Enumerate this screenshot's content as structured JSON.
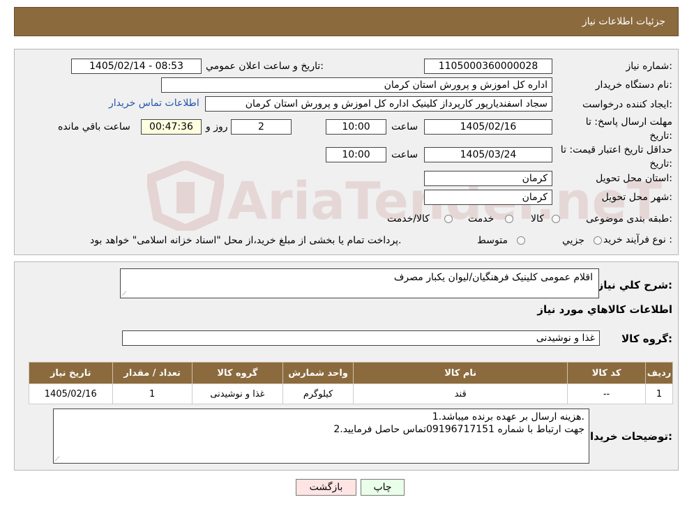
{
  "header": {
    "title": "جزئیات اطلاعات نیاز"
  },
  "watermark": {
    "text": "AriaTender.neT"
  },
  "form": {
    "need_number_label": "شماره نیاز:",
    "need_number": "1105000360000028",
    "announce_label": "تاریخ و ساعت اعلان عمومي:",
    "announce_value": "1405/02/14 - 08:53",
    "buyer_label": "نام دستگاه خريدار:",
    "buyer_value": "اداره کل اموزش و پرورش استان کرمان",
    "creator_label": "ایجاد کننده درخواست:",
    "creator_value": "سجاد اسفندیارپور کارپرداز کلینیک اداره کل اموزش و پرورش استان کرمان",
    "contact_link": "اطلاعات تماس خریدار",
    "deadline_label": "مهلت ارسال پاسخ: تا تاریخ:",
    "deadline_date": "1405/02/16",
    "time_label": "ساعت",
    "deadline_time": "10:00",
    "days_value": "2",
    "days_label": "روز و",
    "remaining_value": "00:47:36",
    "remaining_label": "ساعت باقي مانده",
    "validity_label": "حداقل تاریخ اعتبار قیمت: تا تاریخ:",
    "validity_date": "1405/03/24",
    "validity_time": "10:00",
    "province_label": "استان محل تحویل:",
    "province_value": "کرمان",
    "city_label": "شهر محل تحویل:",
    "city_value": "کرمان",
    "category_label": "طبقه بندی موضوعی:",
    "category_options": [
      "کالا",
      "خدمت",
      "کالا/خدمت"
    ],
    "process_label": "نوع فرآیند خرید :",
    "process_options": [
      "جزیي",
      "متوسط"
    ],
    "process_note": "پرداخت تمام یا بخشی از مبلغ خرید،از محل \"اسناد خزانه اسلامی\" خواهد بود."
  },
  "details": {
    "summary_label": "شرح کلي نياز:",
    "summary_value": "اقلام عمومی کلینیک فرهنگیان/لیوان یکبار مصرف",
    "items_title": "اطلاعات کالاهاي مورد نياز",
    "group_label": "گروه کالا:",
    "group_value": "غذا و نوشیدنی",
    "table": {
      "headers": [
        "رديف",
        "کد کالا",
        "نام کالا",
        "واحد شمارش",
        "گروه کالا",
        "تعداد / مقدار",
        "تاريخ نياز"
      ],
      "rows": [
        [
          "1",
          "--",
          "قند",
          "کیلوگرم",
          "غذا و نوشیدنی",
          "1",
          "1405/02/16"
        ]
      ]
    },
    "buyer_notes_label": "توضیحات خریدار:",
    "buyer_notes_line1": "1.هزینه ارسال بر عهده برنده میباشد.",
    "buyer_notes_line2": "2.جهت ارتباط با شماره 09196717151تماس حاصل فرمایید"
  },
  "buttons": {
    "print": "چاپ",
    "back": "بازگشت"
  },
  "colors": {
    "header_bg": "#8b6a3e",
    "panel_bg": "#f0f0f0",
    "remaining_bg": "#ffffe0",
    "back_btn_bg": "#ffe4e4",
    "print_btn_bg": "#eaffea"
  }
}
